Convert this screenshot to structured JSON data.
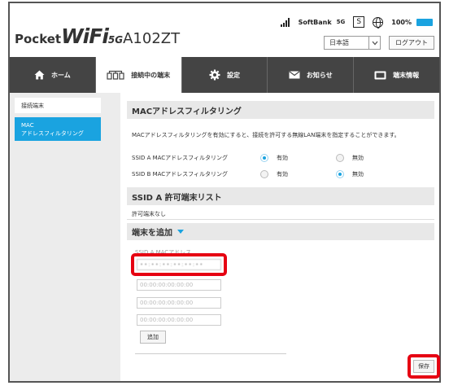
{
  "header": {
    "logo": {
      "pocket": "Pocket",
      "wifi": "WiFi",
      "fiveg": "5G",
      "model": "A102ZT"
    },
    "status": {
      "carrier": "SoftBank",
      "network": "5G",
      "sim_badge": "S",
      "battery": "100%"
    },
    "language": {
      "value": "日本語"
    },
    "logout_label": "ログアウト"
  },
  "nav": {
    "tabs": [
      {
        "label": "ホーム",
        "icon": "home-icon"
      },
      {
        "label": "接続中の端末",
        "icon": "devices-icon",
        "active": true
      },
      {
        "label": "設定",
        "icon": "gear-icon"
      },
      {
        "label": "お知らせ",
        "icon": "mail-icon"
      },
      {
        "label": "端末情報",
        "icon": "device-info-icon"
      }
    ]
  },
  "sidebar": {
    "items": [
      {
        "label": "接続端末"
      },
      {
        "label_line1": "MAC",
        "label_line2": "アドレスフィルタリング",
        "active": true
      }
    ]
  },
  "main": {
    "title": "MACアドレスフィルタリング",
    "description": "MACアドレスフィルタリングを有効にすると、接続を許可する無線LAN端末を指定することができます。",
    "rows": [
      {
        "label": "SSID A MACアドレスフィルタリング",
        "enabled_label": "有効",
        "disabled_label": "無効",
        "selected": "enabled"
      },
      {
        "label": "SSID B MACアドレスフィルタリング",
        "enabled_label": "有効",
        "disabled_label": "無効",
        "selected": "disabled"
      }
    ],
    "list_title": "SSID A 許可端末リスト",
    "list_empty": "許可端末なし",
    "add_title": "端末を追加",
    "mac_label": "SSID A MACアドレス",
    "mac_inputs": {
      "first_value": "••:••:••:••:••:••",
      "placeholder": "00:00:00:00:00:00"
    },
    "add_button": "追加",
    "save_button": "保存"
  },
  "colors": {
    "accent": "#1aa3e0",
    "highlight": "#e60012",
    "nav_bg": "#444444"
  }
}
